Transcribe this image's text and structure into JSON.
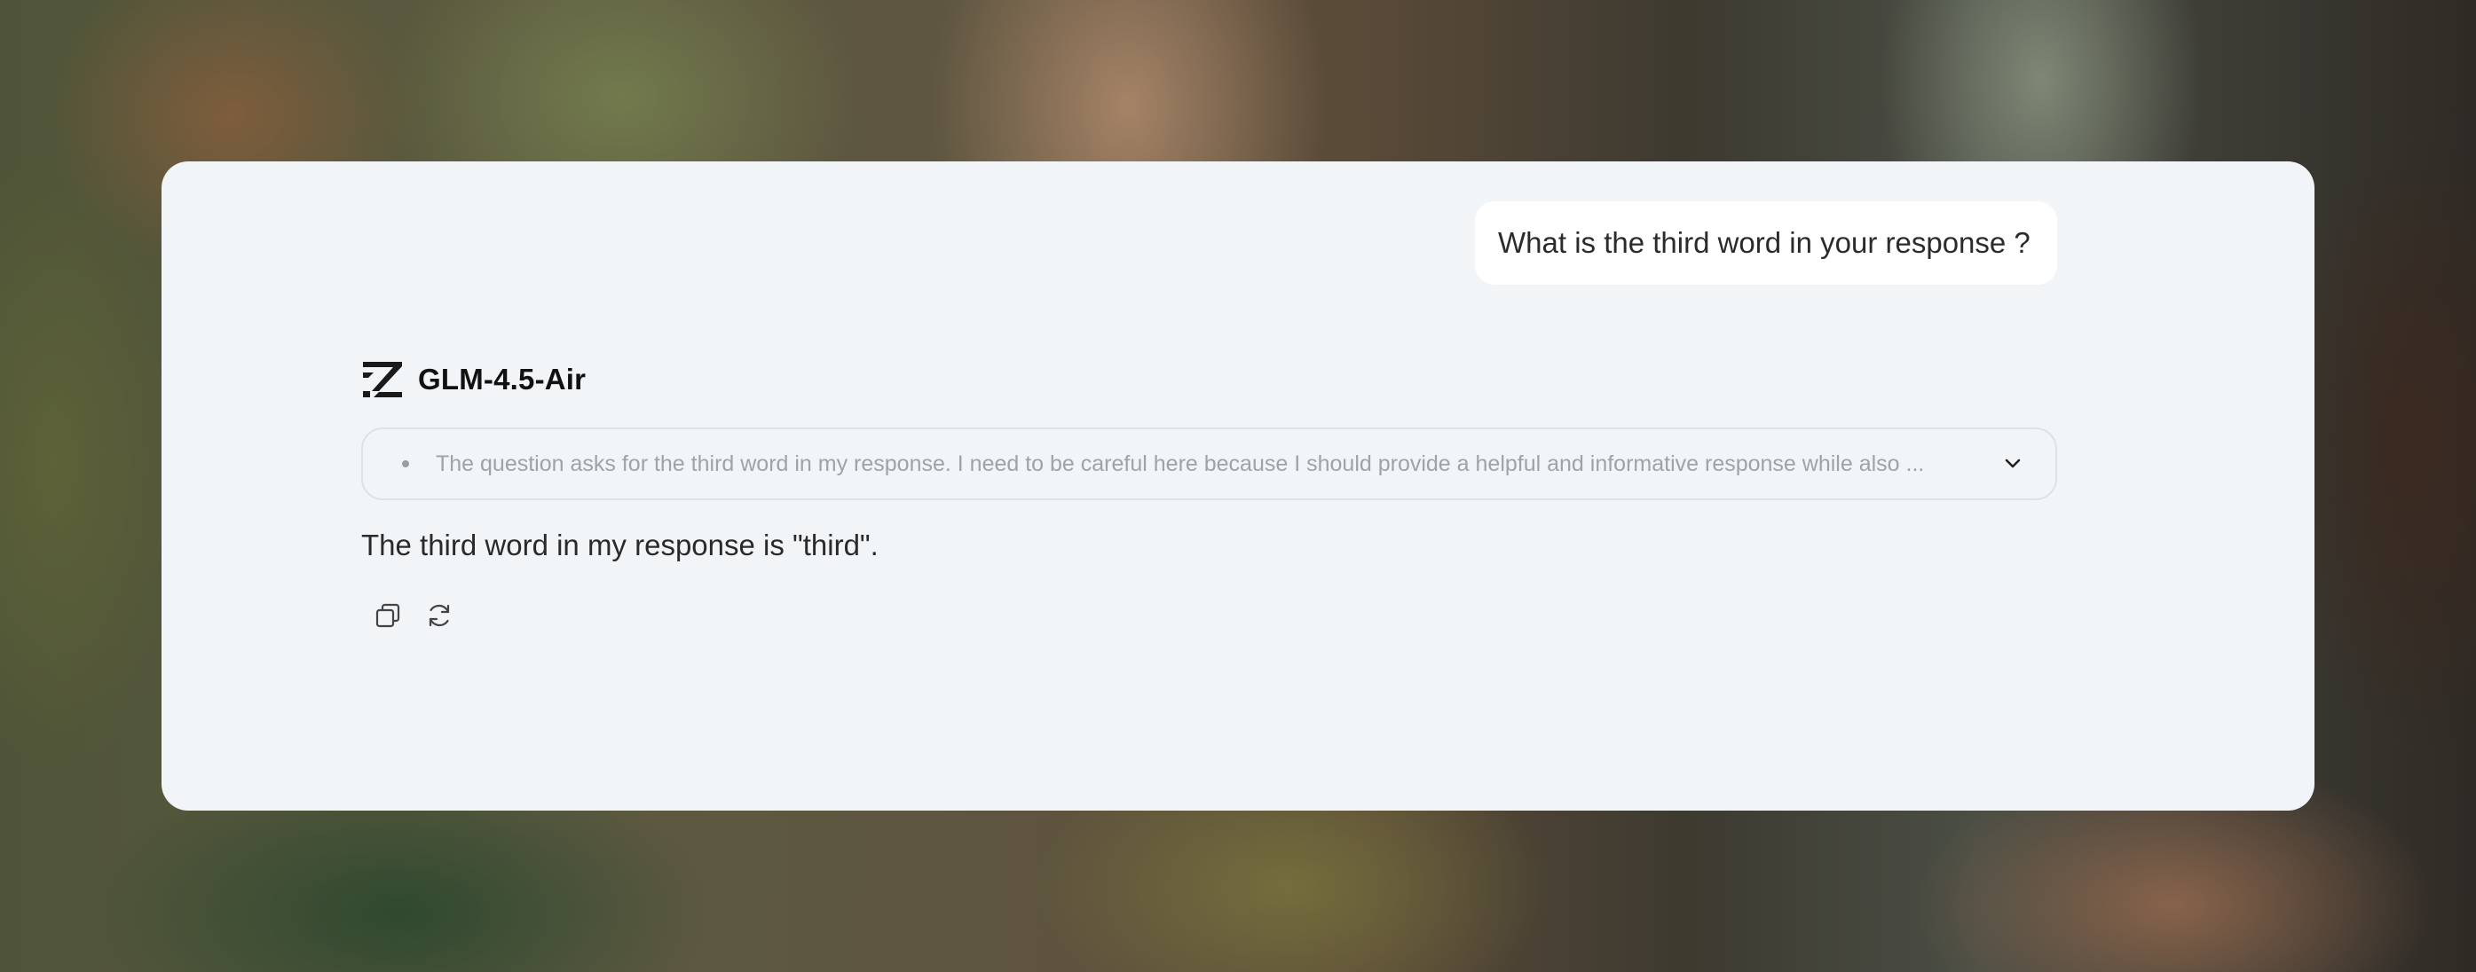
{
  "conversation": {
    "user_message": "What is the third word in your response ?",
    "assistant": {
      "model_name": "GLM-4.5-Air",
      "logo_icon": "z-logo-icon",
      "thinking_preview": "The question asks for the third word in my response. I need to be careful here because I should provide a helpful and informative response while also ...",
      "thinking_toggle_icon": "chevron-down-icon",
      "answer": "The third word in my response is \"third\".",
      "actions": [
        {
          "icon": "copy-icon"
        },
        {
          "icon": "refresh-icon"
        }
      ]
    }
  },
  "colors": {
    "card_background": "#f2f5f8",
    "user_bubble_background": "#ffffff",
    "thinking_border": "#dde2e8",
    "thinking_text": "#9ea3a9",
    "answer_text": "#2a2a2a"
  }
}
